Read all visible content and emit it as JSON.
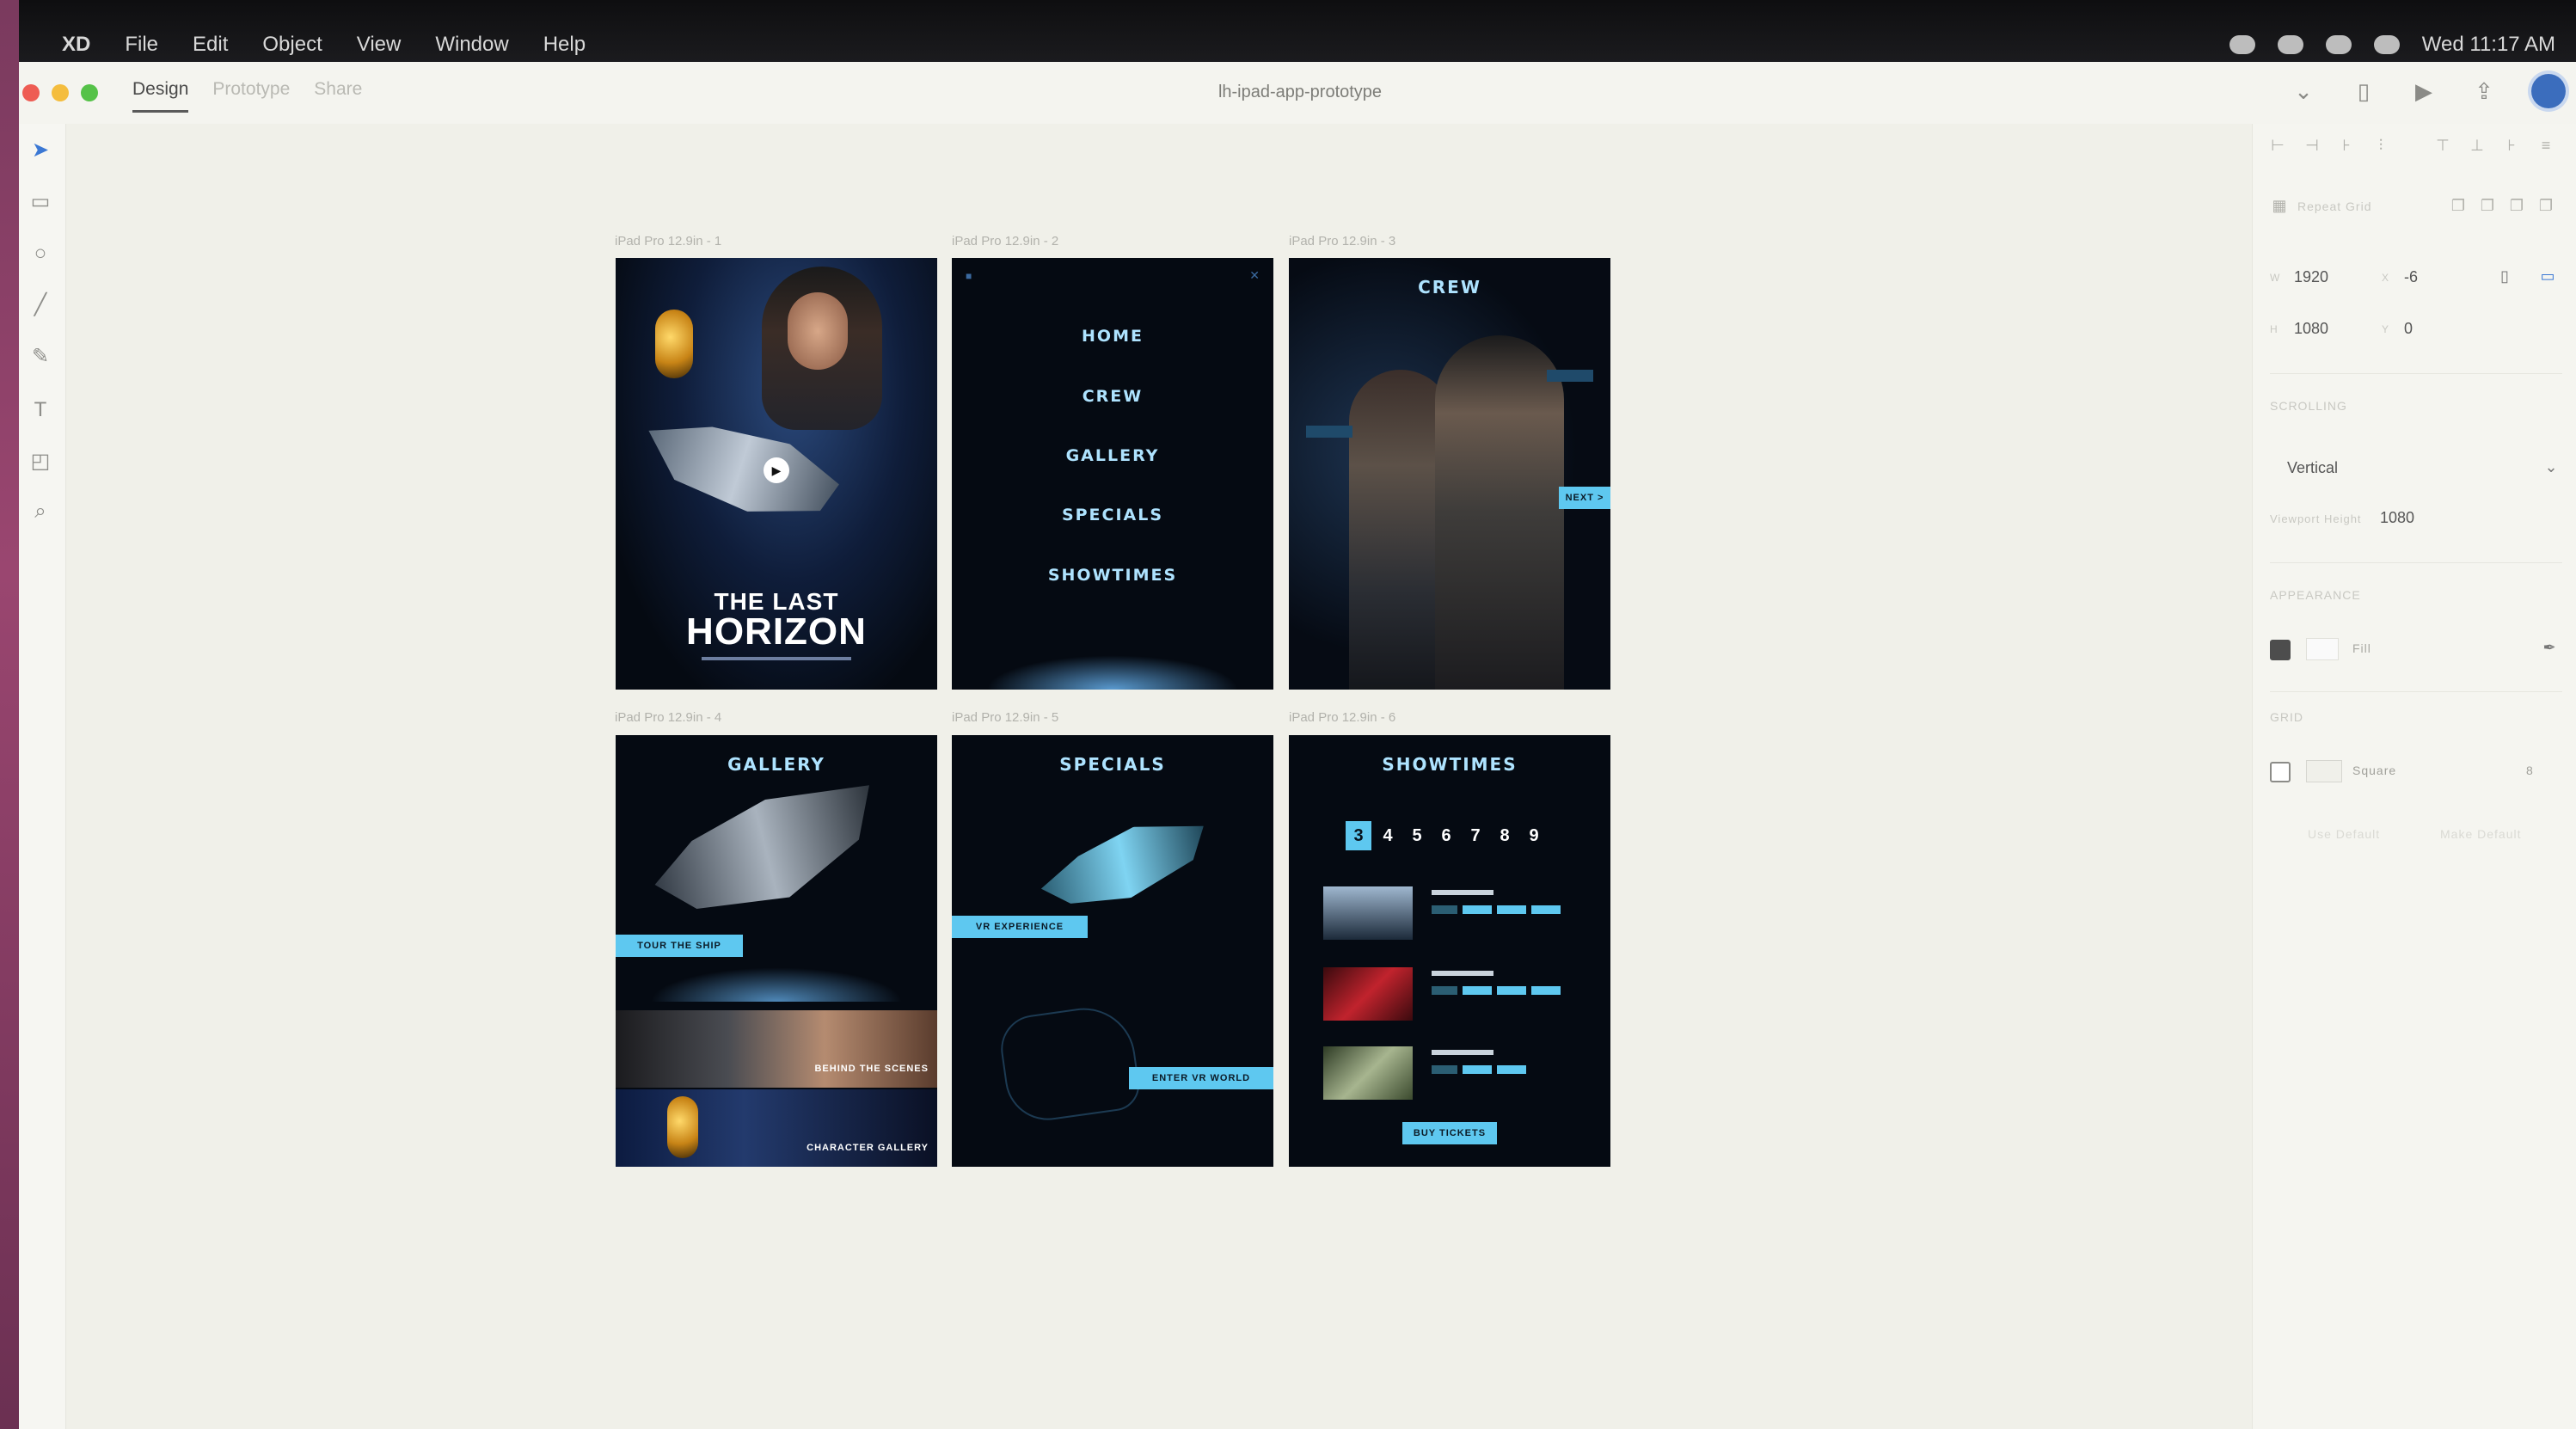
{
  "menubar": {
    "app_name": "XD",
    "items": [
      "File",
      "Edit",
      "Object",
      "View",
      "Window",
      "Help"
    ],
    "clock": "Wed 11:17 AM"
  },
  "titlebar": {
    "tabs": [
      "Design",
      "Prototype",
      "Share"
    ],
    "active_tab": "Design",
    "document_title": "lh-ipad-app-prototype"
  },
  "tools": [
    "select-icon",
    "rectangle-icon",
    "ellipse-icon",
    "line-icon",
    "pen-icon",
    "text-icon",
    "artboard-icon",
    "zoom-icon"
  ],
  "artboards": [
    {
      "label": "iPad Pro 12.9in - 1",
      "poster_title_1": "THE LAST",
      "poster_title_2": "HORIZON",
      "play_icon": "play-icon"
    },
    {
      "label": "iPad Pro 12.9in - 2",
      "nav": [
        "HOME",
        "CREW",
        "GALLERY",
        "SPECIALS",
        "SHOWTIMES"
      ]
    },
    {
      "label": "iPad Pro 12.9in - 3",
      "title": "CREW",
      "next_button": "NEXT >"
    },
    {
      "label": "iPad Pro 12.9in - 4",
      "title": "GALLERY",
      "tour_button": "TOUR THE SHIP",
      "caption_1": "BEHIND THE SCENES",
      "caption_2": "CHARACTER GALLERY"
    },
    {
      "label": "iPad Pro 12.9in - 5",
      "title": "SPECIALS",
      "vr_button": "VR EXPERIENCE",
      "enter_button": "ENTER VR WORLD"
    },
    {
      "label": "iPad Pro 12.9in - 6",
      "title": "SHOWTIMES",
      "dates": [
        "3",
        "4",
        "5",
        "6",
        "7",
        "8",
        "9"
      ],
      "selected_date": "3",
      "buy_button": "BUY TICKETS"
    }
  ],
  "panel": {
    "width_value": "1920",
    "x_value": "-6",
    "height_value": "1080",
    "y_value": "0",
    "scrolling_heading": "SCROLLING",
    "scrolling_option": "Vertical",
    "viewport_label": "Viewport Height",
    "viewport_value": "1080",
    "appearance_heading": "APPEARANCE",
    "fill_label": "Fill",
    "fill_checked": true,
    "grid_heading": "GRID",
    "grid_type": "Square",
    "grid_value": "8",
    "grid_checked": false,
    "use_default": "Use Default",
    "make_default": "Make Default",
    "repeat_grid": "Repeat Grid"
  }
}
